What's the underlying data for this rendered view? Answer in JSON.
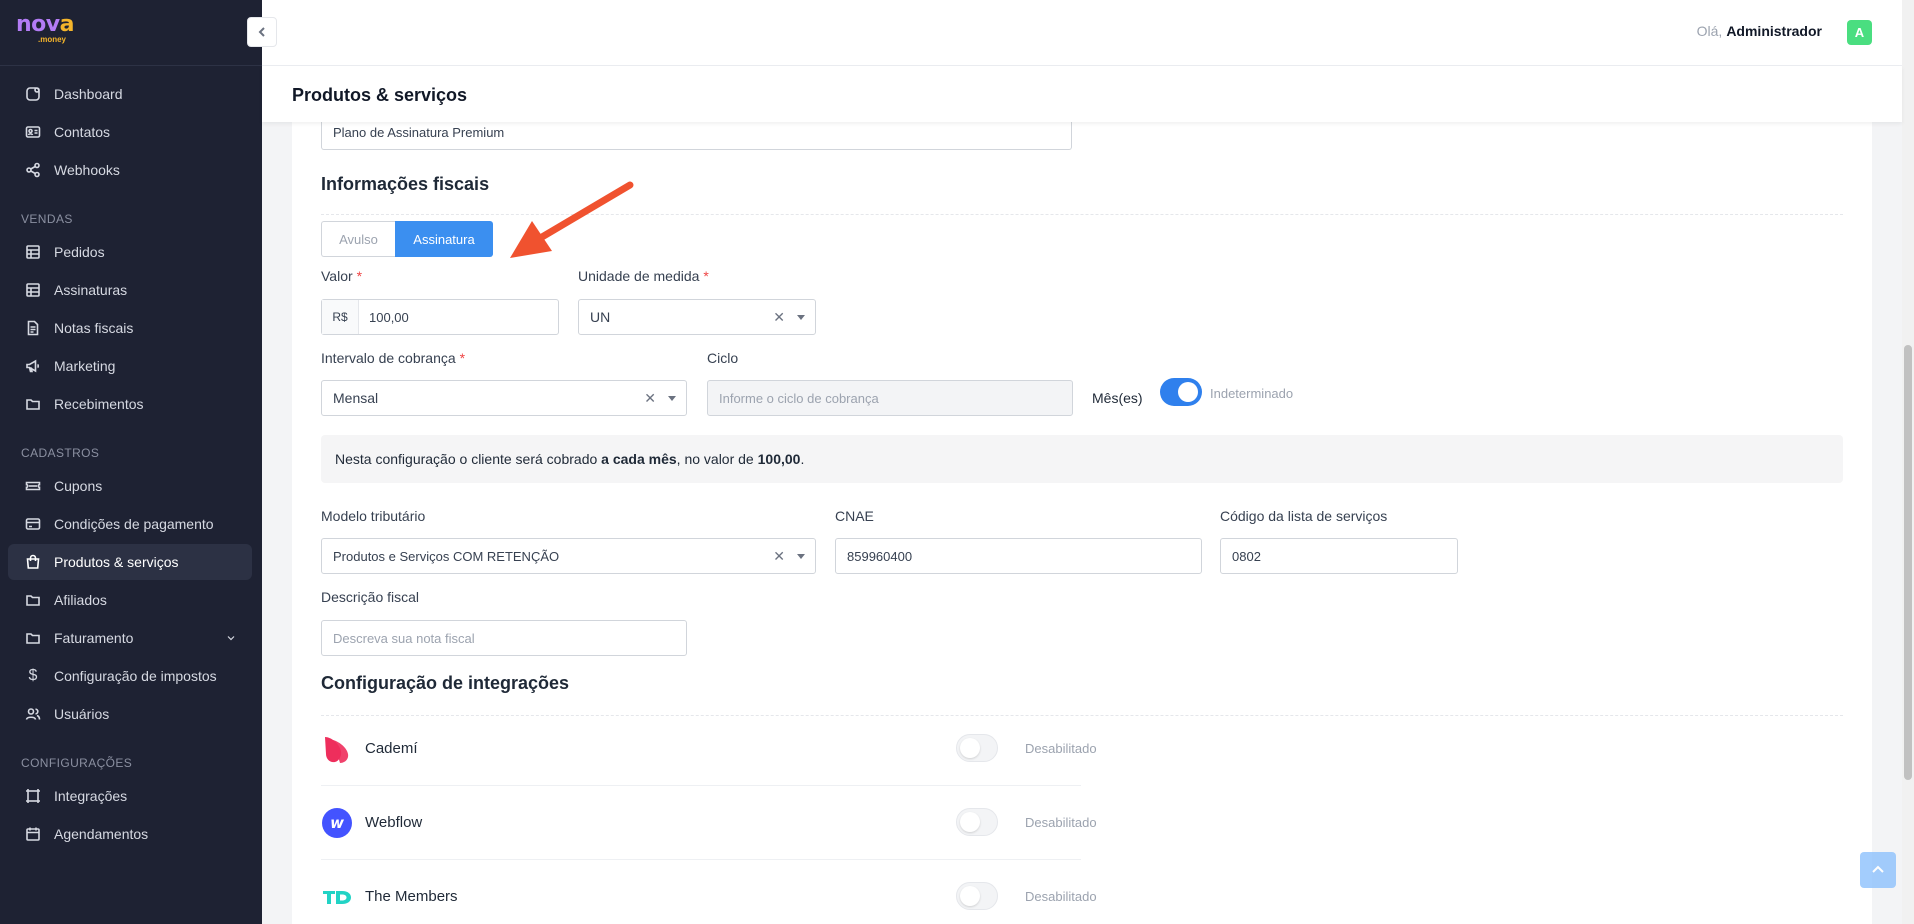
{
  "brand": {
    "name_part1": "nov",
    "name_part2": "a",
    "subtitle": ".money"
  },
  "header": {
    "greeting": "Olá,",
    "user_name": "Administrador",
    "avatar_letter": "A"
  },
  "page": {
    "title": "Produtos & serviços"
  },
  "sidebar": {
    "items_top": [
      {
        "label": "Dashboard",
        "icon": "dashboard-icon"
      },
      {
        "label": "Contatos",
        "icon": "contacts-icon"
      },
      {
        "label": "Webhooks",
        "icon": "share-icon"
      }
    ],
    "section_vendas": "VENDAS",
    "items_vendas": [
      {
        "label": "Pedidos",
        "icon": "table-icon"
      },
      {
        "label": "Assinaturas",
        "icon": "table-icon"
      },
      {
        "label": "Notas fiscais",
        "icon": "document-icon"
      },
      {
        "label": "Marketing",
        "icon": "megaphone-icon"
      },
      {
        "label": "Recebimentos",
        "icon": "folder-icon"
      }
    ],
    "section_cadastros": "CADASTROS",
    "items_cadastros": [
      {
        "label": "Cupons",
        "icon": "ticket-icon"
      },
      {
        "label": "Condições de pagamento",
        "icon": "credit-card-icon"
      },
      {
        "label": "Produtos & serviços",
        "icon": "shopping-bag-icon",
        "active": true
      },
      {
        "label": "Afiliados",
        "icon": "folder-icon"
      },
      {
        "label": "Faturamento",
        "icon": "folder-icon"
      },
      {
        "label": "Configuração de impostos",
        "icon": "dollar-icon"
      },
      {
        "label": "Usuários",
        "icon": "users-icon"
      }
    ],
    "section_config": "CONFIGURAÇÕES",
    "items_config": [
      {
        "label": "Integrações",
        "icon": "frame-icon"
      },
      {
        "label": "Agendamentos",
        "icon": "calendar-icon"
      }
    ]
  },
  "form": {
    "name_value": "Plano de Assinatura Premium",
    "fiscal_title": "Informações fiscais",
    "type_tabs": [
      "Avulso",
      "Assinatura"
    ],
    "valor_label": "Valor",
    "valor_prefix": "R$",
    "valor_value": "100,00",
    "unidade_label": "Unidade de medida",
    "unidade_value": "UN",
    "intervalo_label": "Intervalo de cobrança",
    "intervalo_value": "Mensal",
    "ciclo_label": "Ciclo",
    "ciclo_placeholder": "Informe o ciclo de cobrança",
    "ciclo_unit": "Mês(es)",
    "indeterminado_label": "Indeterminado",
    "info_prefix": "Nesta configuração o cliente será cobrado",
    "info_bold1": "a cada mês",
    "info_middle": ", no valor de",
    "info_bold2": "100,00",
    "info_suffix": ".",
    "modelo_label": "Modelo tributário",
    "modelo_value": "Produtos e Serviços COM RETENÇÃO",
    "cnae_label": "CNAE",
    "cnae_value": "859960400",
    "codigo_label": "Código da lista de serviços",
    "codigo_value": "0802",
    "descricao_label": "Descrição fiscal",
    "descricao_placeholder": "Descreva sua nota fiscal",
    "integ_title": "Configuração de integrações",
    "integrations": [
      {
        "name": "Cademí",
        "state": "Desabilitado"
      },
      {
        "name": "Webflow",
        "state": "Desabilitado"
      },
      {
        "name": "The Members",
        "state": "Desabilitado"
      }
    ]
  },
  "colors": {
    "accent": "#3b82f6",
    "sidebar_bg": "#1e2233",
    "arrow": "#f0522f",
    "toggle_on": "#2f80ed"
  }
}
